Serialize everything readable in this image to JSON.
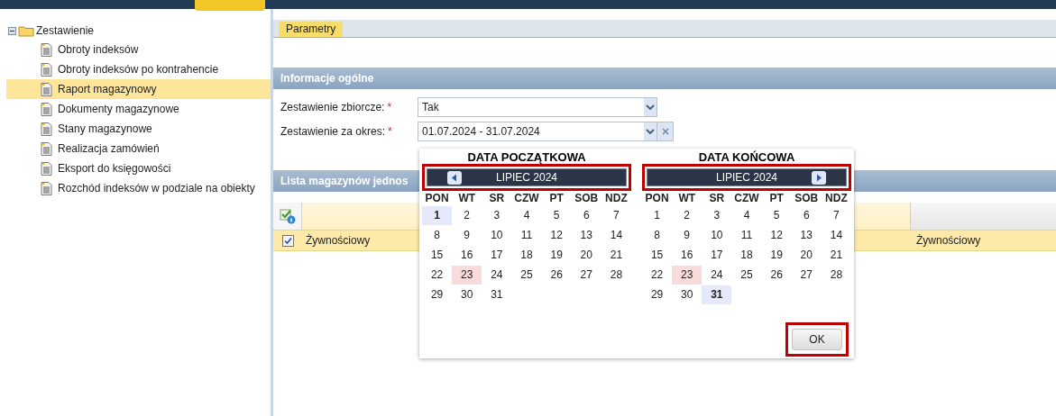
{
  "tree": {
    "label": "Zestawienie",
    "expanded": true,
    "children": [
      {
        "label": "Obroty indeksów",
        "selected": false
      },
      {
        "label": "Obroty indeksów po kontrahencie",
        "selected": false
      },
      {
        "label": "Raport magazynowy",
        "selected": true
      },
      {
        "label": "Dokumenty magazynowe",
        "selected": false
      },
      {
        "label": "Stany magazynowe",
        "selected": false
      },
      {
        "label": "Realizacja zamówień",
        "selected": false
      },
      {
        "label": "Eksport do księgowości",
        "selected": false
      },
      {
        "label": "Rozchód indeksów w podziale na obiekty",
        "selected": false
      }
    ]
  },
  "tabs": [
    {
      "label": "Parametry",
      "selected": true
    }
  ],
  "section_general": {
    "title": "Informacje ogólne",
    "fields": [
      {
        "label": "Zestawienie zbiorcze:",
        "required_mark": "*",
        "value": "Tak",
        "clearable": false
      },
      {
        "label": "Zestawienie za okres:",
        "required_mark": "*",
        "value": "01.07.2024 - 31.07.2024",
        "clearable": true
      }
    ]
  },
  "section_list": {
    "title": "Lista magazynów jednos",
    "rows": [
      {
        "checked": true,
        "column_2": "Żywnościowy",
        "column_3": "Żywnościowy"
      }
    ]
  },
  "date_picker": {
    "calendars": [
      {
        "kind": "start",
        "title": "DATA POCZĄTKOWA",
        "month": "LIPIEC 2024",
        "highlighted": true,
        "weekdays": [
          "PON",
          "WT",
          "SR",
          "CZW",
          "PT",
          "SOB",
          "NDZ"
        ],
        "days": [
          {
            "day": "1",
            "selected": true,
            "today": false
          },
          {
            "day": "2",
            "selected": false,
            "today": false
          },
          {
            "day": "3",
            "selected": false,
            "today": false
          },
          {
            "day": "4",
            "selected": false,
            "today": false
          },
          {
            "day": "5",
            "selected": false,
            "today": false
          },
          {
            "day": "6",
            "selected": false,
            "today": false
          },
          {
            "day": "7",
            "selected": false,
            "today": false
          },
          {
            "day": "8",
            "selected": false,
            "today": false
          },
          {
            "day": "9",
            "selected": false,
            "today": false
          },
          {
            "day": "10",
            "selected": false,
            "today": false
          },
          {
            "day": "11",
            "selected": false,
            "today": false
          },
          {
            "day": "12",
            "selected": false,
            "today": false
          },
          {
            "day": "13",
            "selected": false,
            "today": false
          },
          {
            "day": "14",
            "selected": false,
            "today": false
          },
          {
            "day": "15",
            "selected": false,
            "today": false
          },
          {
            "day": "16",
            "selected": false,
            "today": false
          },
          {
            "day": "17",
            "selected": false,
            "today": false
          },
          {
            "day": "18",
            "selected": false,
            "today": false
          },
          {
            "day": "19",
            "selected": false,
            "today": false
          },
          {
            "day": "20",
            "selected": false,
            "today": false
          },
          {
            "day": "21",
            "selected": false,
            "today": false
          },
          {
            "day": "22",
            "selected": false,
            "today": false
          },
          {
            "day": "23",
            "selected": false,
            "today": true
          },
          {
            "day": "24",
            "selected": false,
            "today": false
          },
          {
            "day": "25",
            "selected": false,
            "today": false
          },
          {
            "day": "26",
            "selected": false,
            "today": false
          },
          {
            "day": "27",
            "selected": false,
            "today": false
          },
          {
            "day": "28",
            "selected": false,
            "today": false
          },
          {
            "day": "29",
            "selected": false,
            "today": false
          },
          {
            "day": "30",
            "selected": false,
            "today": false
          },
          {
            "day": "31",
            "selected": false,
            "today": false
          }
        ]
      },
      {
        "kind": "end",
        "title": "DATA KOŃCOWA",
        "month": "LIPIEC 2024",
        "highlighted": true,
        "weekdays": [
          "PON",
          "WT",
          "SR",
          "CZW",
          "PT",
          "SOB",
          "NDZ"
        ],
        "days": [
          {
            "day": "1",
            "selected": false,
            "today": false
          },
          {
            "day": "2",
            "selected": false,
            "today": false
          },
          {
            "day": "3",
            "selected": false,
            "today": false
          },
          {
            "day": "4",
            "selected": false,
            "today": false
          },
          {
            "day": "5",
            "selected": false,
            "today": false
          },
          {
            "day": "6",
            "selected": false,
            "today": false
          },
          {
            "day": "7",
            "selected": false,
            "today": false
          },
          {
            "day": "8",
            "selected": false,
            "today": false
          },
          {
            "day": "9",
            "selected": false,
            "today": false
          },
          {
            "day": "10",
            "selected": false,
            "today": false
          },
          {
            "day": "11",
            "selected": false,
            "today": false
          },
          {
            "day": "12",
            "selected": false,
            "today": false
          },
          {
            "day": "13",
            "selected": false,
            "today": false
          },
          {
            "day": "14",
            "selected": false,
            "today": false
          },
          {
            "day": "15",
            "selected": false,
            "today": false
          },
          {
            "day": "16",
            "selected": false,
            "today": false
          },
          {
            "day": "17",
            "selected": false,
            "today": false
          },
          {
            "day": "18",
            "selected": false,
            "today": false
          },
          {
            "day": "19",
            "selected": false,
            "today": false
          },
          {
            "day": "20",
            "selected": false,
            "today": false
          },
          {
            "day": "21",
            "selected": false,
            "today": false
          },
          {
            "day": "22",
            "selected": false,
            "today": false
          },
          {
            "day": "23",
            "selected": false,
            "today": true
          },
          {
            "day": "24",
            "selected": false,
            "today": false
          },
          {
            "day": "25",
            "selected": false,
            "today": false
          },
          {
            "day": "26",
            "selected": false,
            "today": false
          },
          {
            "day": "27",
            "selected": false,
            "today": false
          },
          {
            "day": "28",
            "selected": false,
            "today": false
          },
          {
            "day": "29",
            "selected": false,
            "today": false
          },
          {
            "day": "30",
            "selected": false,
            "today": false
          },
          {
            "day": "31",
            "selected": true,
            "today": false
          }
        ]
      }
    ],
    "ok_button": {
      "label": "OK",
      "highlighted": true
    }
  }
}
